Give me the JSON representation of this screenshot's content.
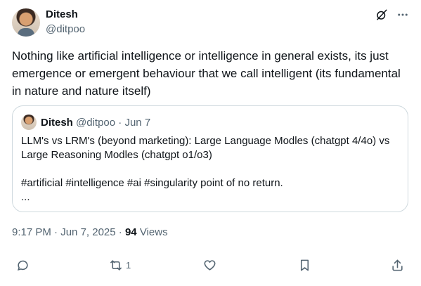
{
  "author": {
    "name": "Ditesh",
    "handle": "@ditpoo"
  },
  "icons": {
    "grok": "grok-icon",
    "more": "more-dots-icon"
  },
  "post": {
    "text": "Nothing like artificial intelligence or intelligence in general exists, its just emergence or emergent behaviour that we call intelligent (its fundamental in nature and nature itself)"
  },
  "quote": {
    "name": "Ditesh",
    "handle": "@ditpoo",
    "date": "Jun 7",
    "separator": "·",
    "line1": "LLM's vs LRM's (beyond marketing): Large Language Modles (chatgpt 4/4o) vs Large Reasoning Modles (chatgpt o1/o3)",
    "line2": "#artificial #intelligence #ai #singularity point of no return.",
    "ellipsis": "..."
  },
  "meta": {
    "time": "9:17 PM",
    "date": "Jun 7, 2025",
    "separator": "·",
    "views_count": "94",
    "views_label": "Views"
  },
  "actions": {
    "reply_count": "",
    "repost_count": "1",
    "like_count": "",
    "bookmark_count": ""
  },
  "colors": {
    "text": "#0f1419",
    "secondary": "#536471",
    "border": "#cfd9de"
  }
}
